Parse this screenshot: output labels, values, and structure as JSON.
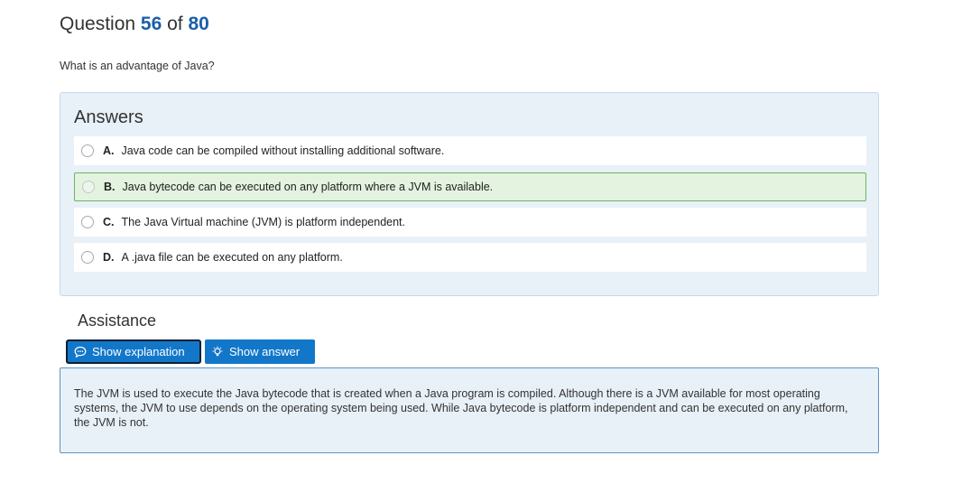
{
  "question": {
    "prefix": "Question",
    "current": "56",
    "separator": "of",
    "total": "80",
    "text": "What is an advantage of Java?"
  },
  "answers": {
    "title": "Answers",
    "options": [
      {
        "letter": "A.",
        "text": "Java code can be compiled without installing additional software.",
        "correct": false
      },
      {
        "letter": "B.",
        "text": "Java bytecode can be executed on any platform where a JVM is available.",
        "correct": true
      },
      {
        "letter": "C.",
        "text": "The Java Virtual machine (JVM) is platform independent.",
        "correct": false
      },
      {
        "letter": "D.",
        "text": "A .java file can be executed on any platform.",
        "correct": false
      }
    ]
  },
  "assistance": {
    "title": "Assistance",
    "show_explanation_label": "Show explanation",
    "show_answer_label": "Show answer",
    "explanation_text": "The JVM is used to execute the Java bytecode that is created when a Java program is compiled. Although there is a JVM available for most operating systems, the JVM to use depends on the operating system being used. While Java bytecode is platform independent and can be executed on any platform, the JVM is not."
  },
  "colors": {
    "accent": "#1277c9",
    "correct_border": "#6cb563",
    "panel_bg": "#e8f1f8"
  },
  "icons": {
    "explanation": "speech-bubble-icon",
    "answer": "lightbulb-icon"
  }
}
